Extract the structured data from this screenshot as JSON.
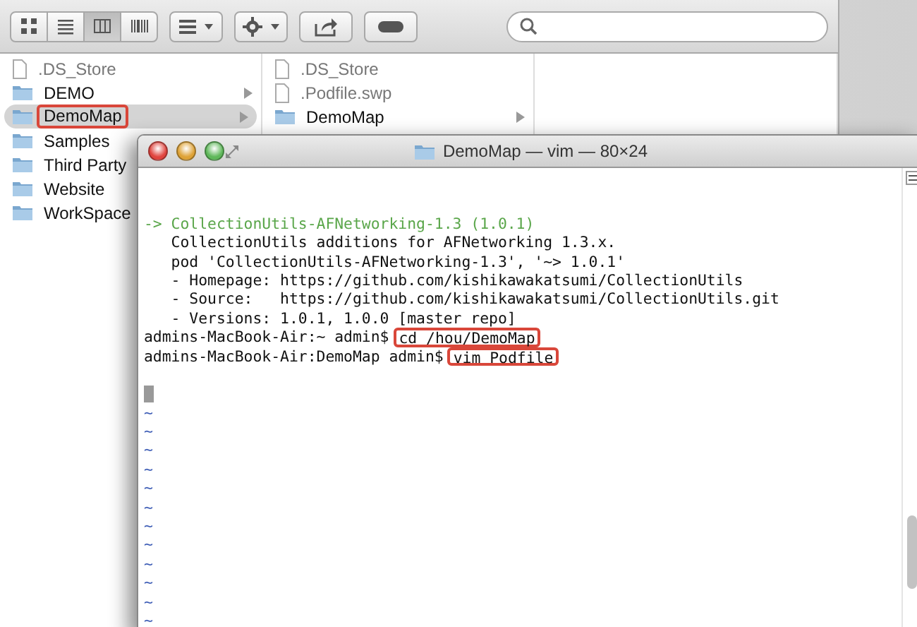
{
  "finder": {
    "toolbar": {
      "view_modes": [
        {
          "kind": "icons",
          "selected": false
        },
        {
          "kind": "list",
          "selected": false
        },
        {
          "kind": "columns",
          "selected": true
        },
        {
          "kind": "coverflow",
          "selected": false
        }
      ]
    },
    "columns": [
      {
        "items": [
          {
            "name": ".DS_Store",
            "kind": "file",
            "dimmed": true,
            "selected": false,
            "has_children": false,
            "annotated": false
          },
          {
            "name": "DEMO",
            "kind": "folder",
            "dimmed": false,
            "selected": false,
            "has_children": true,
            "annotated": false
          },
          {
            "name": "DemoMap",
            "kind": "folder",
            "dimmed": false,
            "selected": true,
            "has_children": true,
            "annotated": true
          },
          {
            "name": "Samples",
            "kind": "folder",
            "dimmed": false,
            "selected": false,
            "has_children": false,
            "annotated": false
          },
          {
            "name": "Third Party",
            "kind": "folder",
            "dimmed": false,
            "selected": false,
            "has_children": false,
            "annotated": false
          },
          {
            "name": "Website",
            "kind": "folder",
            "dimmed": false,
            "selected": false,
            "has_children": false,
            "annotated": false
          },
          {
            "name": "WorkSpace",
            "kind": "folder",
            "dimmed": false,
            "selected": false,
            "has_children": false,
            "annotated": false
          }
        ]
      },
      {
        "items": [
          {
            "name": ".DS_Store",
            "kind": "file",
            "dimmed": true,
            "selected": false,
            "has_children": false,
            "annotated": false
          },
          {
            "name": ".Podfile.swp",
            "kind": "file",
            "dimmed": true,
            "selected": false,
            "has_children": false,
            "annotated": false
          },
          {
            "name": "DemoMap",
            "kind": "folder",
            "dimmed": false,
            "selected": false,
            "has_children": true,
            "annotated": false
          }
        ]
      },
      {}
    ]
  },
  "terminal": {
    "title": "DemoMap — vim — 80×24",
    "lines": [
      {
        "kind": "blank"
      },
      {
        "kind": "blank"
      },
      {
        "kind": "info",
        "text": "-> CollectionUtils-AFNetworking-1.3 (1.0.1)"
      },
      {
        "kind": "output",
        "text": "   CollectionUtils additions for AFNetworking 1.3.x."
      },
      {
        "kind": "output",
        "text": "   pod 'CollectionUtils-AFNetworking-1.3', '~> 1.0.1'"
      },
      {
        "kind": "output",
        "text": "   - Homepage: https://github.com/kishikawakatsumi/CollectionUtils"
      },
      {
        "kind": "output",
        "text": "   - Source:   https://github.com/kishikawakatsumi/CollectionUtils.git"
      },
      {
        "kind": "output",
        "text": "   - Versions: 1.0.1, 1.0.0 [master repo]"
      },
      {
        "kind": "prompt",
        "prompt": "admins-MacBook-Air:~ admin$",
        "command": "cd /hou/DemoMap",
        "annotated": true
      },
      {
        "kind": "prompt",
        "prompt": "admins-MacBook-Air:DemoMap admin$",
        "command": "vim Podfile",
        "annotated": true
      },
      {
        "kind": "blank"
      },
      {
        "kind": "cursor"
      },
      {
        "kind": "tilde",
        "text": "~"
      },
      {
        "kind": "tilde",
        "text": "~"
      },
      {
        "kind": "tilde",
        "text": "~"
      },
      {
        "kind": "tilde",
        "text": "~"
      },
      {
        "kind": "tilde",
        "text": "~"
      },
      {
        "kind": "tilde",
        "text": "~"
      },
      {
        "kind": "tilde",
        "text": "~"
      },
      {
        "kind": "tilde",
        "text": "~"
      },
      {
        "kind": "tilde",
        "text": "~"
      },
      {
        "kind": "tilde",
        "text": "~"
      },
      {
        "kind": "tilde",
        "text": "~"
      },
      {
        "kind": "tilde",
        "text": "~"
      }
    ]
  }
}
